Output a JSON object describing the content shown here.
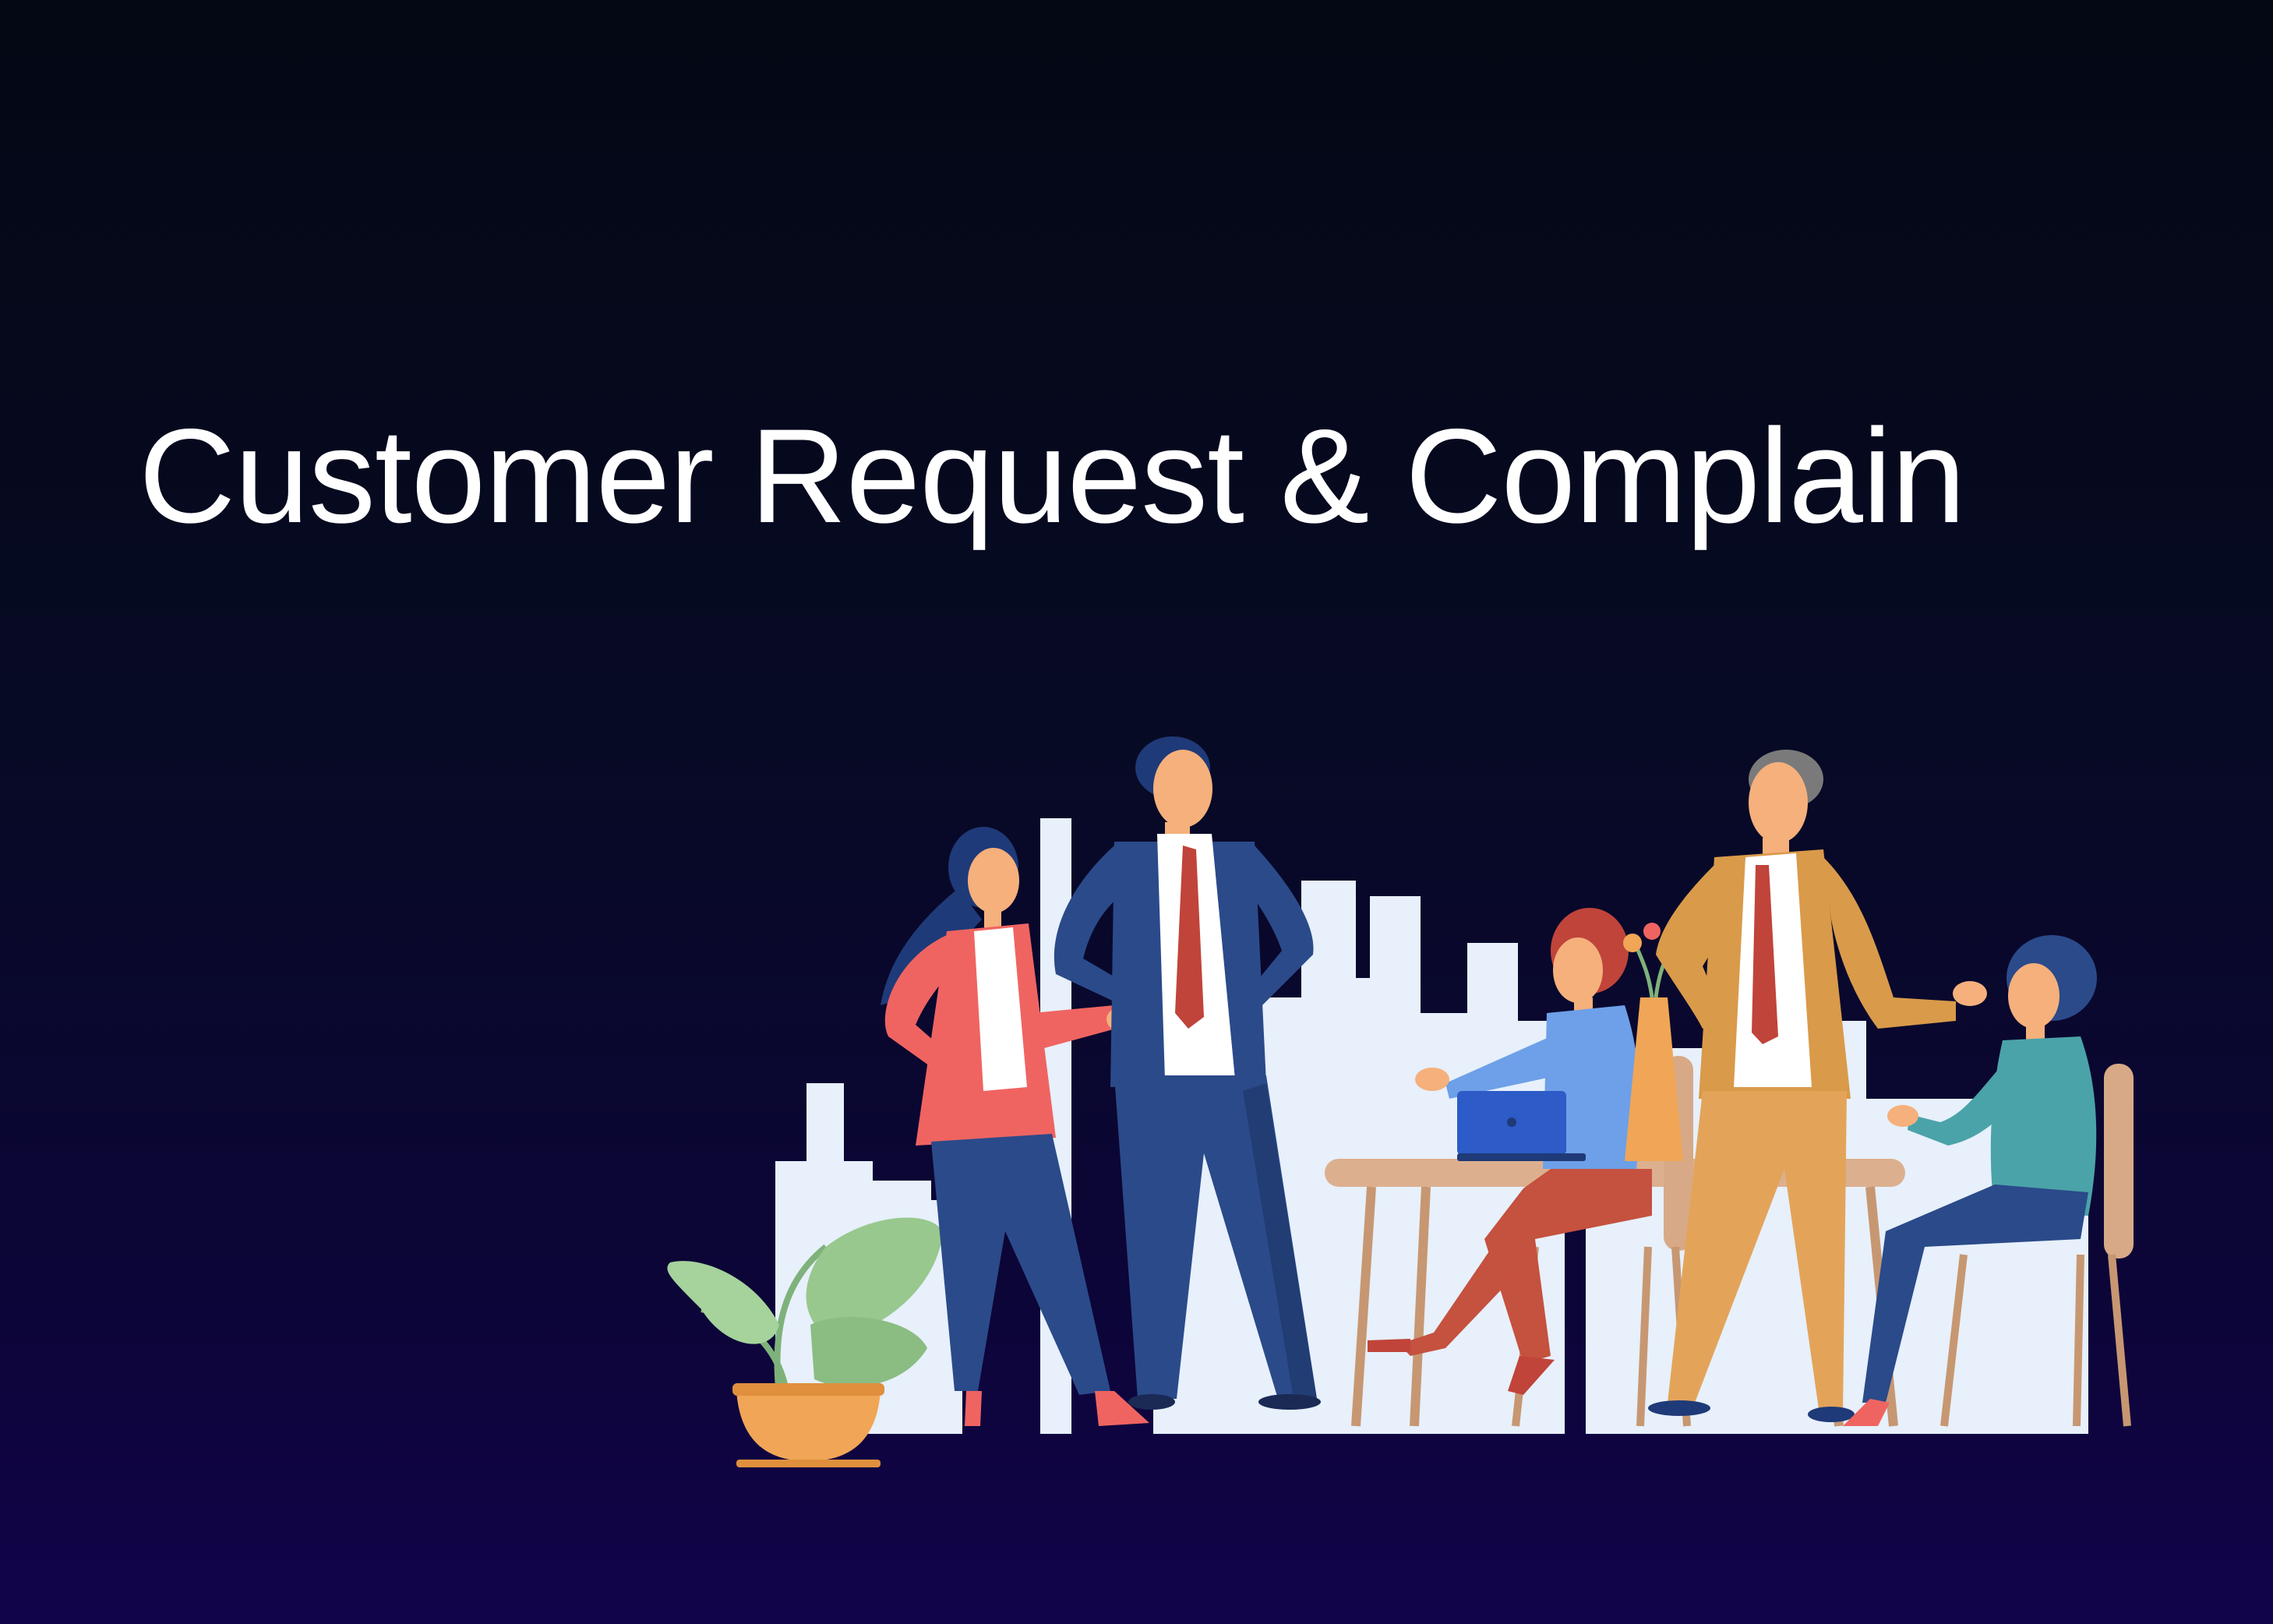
{
  "slide": {
    "title": "Customer Request & Complain"
  },
  "illustration": {
    "subject": "office-team-meeting",
    "colors": {
      "background_top": "#040814",
      "background_bottom": "#12044a",
      "skyline": "#e7f0fb",
      "navy_suit": "#2b4a8a",
      "coral_jacket": "#ef6461",
      "tan_suit": "#d99a4a",
      "skin": "#f5b07c",
      "table": "#dcb08f",
      "plant": "#98c88e",
      "pot": "#f0a656"
    }
  }
}
